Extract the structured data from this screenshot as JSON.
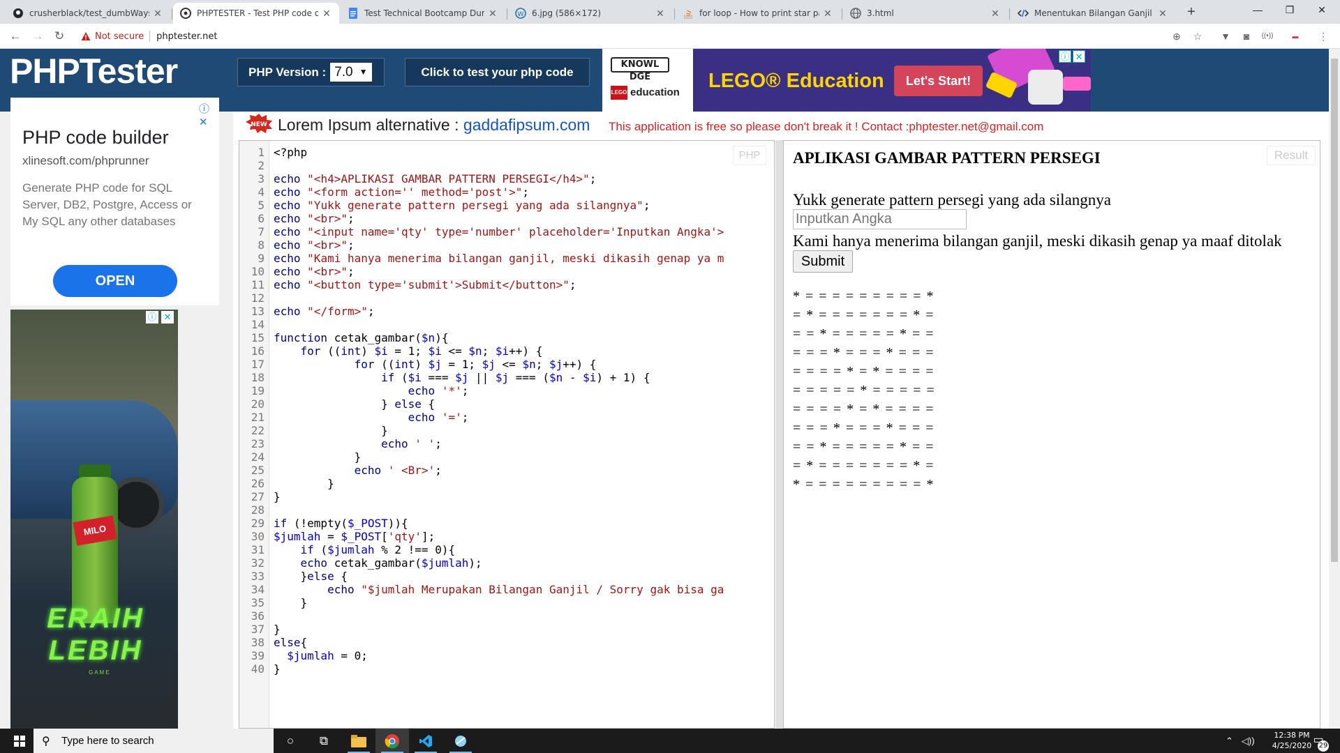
{
  "tabs": [
    {
      "title": "crusherblack/test_dumbWaysId",
      "icon": "github-icon",
      "active": false
    },
    {
      "title": "PHPTESTER - Test PHP code onlin",
      "icon": "phptester-icon",
      "active": true
    },
    {
      "title": "Test Technical Bootcamp DumbW",
      "icon": "google-docs-icon",
      "active": false
    },
    {
      "title": "6.jpg (586×172)",
      "icon": "wordpress-icon",
      "active": false
    },
    {
      "title": "for loop - How to print star patte",
      "icon": "stackoverflow-icon",
      "active": false
    },
    {
      "title": "3.html",
      "icon": "globe-icon",
      "active": false
    },
    {
      "title": "Menentukan Bilangan Ganjil Gen",
      "icon": "code-icon",
      "active": false
    }
  ],
  "address": {
    "security_label": "Not secure",
    "url": "phptester.net"
  },
  "header": {
    "logo": "PHPTester",
    "version_label": "PHP Version :",
    "version_value": "7.0",
    "test_button": "Click to test your php code"
  },
  "top_ad": {
    "knowledge_hub": "KNOWL DGE",
    "lego_mini": "LEGO",
    "lego_mini_text": "education",
    "headline": "LEGO® Education",
    "cta": "Let's Start!",
    "colors": {
      "background": "#3a2f82",
      "headline": "#ffd500",
      "cta": "#d4455c"
    }
  },
  "side_ad": {
    "title": "PHP code builder",
    "domain": "xlinesoft.com/phprunner",
    "body": "Generate PHP code for SQL Server, DB2, Postgre, Access or My SQL any other databases",
    "open_label": "OPEN"
  },
  "side_ad2": {
    "label": "MILO",
    "slogan": "ERAIH LEBIH",
    "sub": "GAME"
  },
  "banner": {
    "new_badge": "NEW",
    "lorem_prefix": "Lorem Ipsum alternative : ",
    "lorem_link": "gaddafipsum.com",
    "free_text": "This application is free so please don't break it ! Contact :phptester.net@gmail.com"
  },
  "editor": {
    "tag": "PHP",
    "lines": [
      "<?php",
      "",
      "echo \"<h4>APLIKASI GAMBAR PATTERN PERSEGI</h4>\";",
      "echo \"<form action='' method='post'>\";",
      "echo \"Yukk generate pattern persegi yang ada silangnya\";",
      "echo \"<br>\";",
      "echo \"<input name='qty' type='number' placeholder='Inputkan Angka'>",
      "echo \"<br>\";",
      "echo \"Kami hanya menerima bilangan ganjil, meski dikasih genap ya m",
      "echo \"<br>\";",
      "echo \"<button type='submit'>Submit</button>\";",
      "",
      "echo \"</form>\";",
      "",
      "function cetak_gambar($n){",
      "    for ((int) $i = 1; $i <= $n; $i++) {",
      "            for ((int) $j = 1; $j <= $n; $j++) {",
      "                if ($i === $j || $j === ($n - $i) + 1) {",
      "                    echo '*';",
      "                } else {",
      "                    echo '=';",
      "                }",
      "                echo ' ';",
      "            }",
      "            echo ' <Br>';",
      "        }",
      "}",
      "",
      "if (!empty($_POST)){",
      "$jumlah = $_POST['qty'];",
      "    if ($jumlah % 2 !== 0){",
      "    echo cetak_gambar($jumlah);",
      "    }else {",
      "        echo \"$jumlah Merupakan Bilangan Ganjil / Sorry gak bisa ga",
      "    }",
      "",
      "}",
      "else{",
      "  $jumlah = 0;",
      "}"
    ]
  },
  "result": {
    "tag": "Result",
    "title": "APLIKASI GAMBAR PATTERN PERSEGI",
    "subtitle": "Yukk generate pattern persegi yang ada silangnya",
    "input_placeholder": "Inputkan Angka",
    "note": "Kami hanya menerima bilangan ganjil, meski dikasih genap ya maaf ditolak",
    "submit": "Submit",
    "pattern": [
      "* = = = = = = = = = *",
      "= * = = = = = = = * =",
      "= = * = = = = = * = =",
      "= = = * = = = * = = =",
      "= = = = * = * = = = =",
      "= = = = = * = = = = =",
      "= = = = * = * = = = =",
      "= = = * = = = * = = =",
      "= = * = = = = = * = =",
      "= * = = = = = = = * =",
      "* = = = = = = = = = *"
    ]
  },
  "taskbar": {
    "search_placeholder": "Type here to search",
    "time": "12:38 PM",
    "date": "4/25/2020",
    "notification_count": "29"
  }
}
